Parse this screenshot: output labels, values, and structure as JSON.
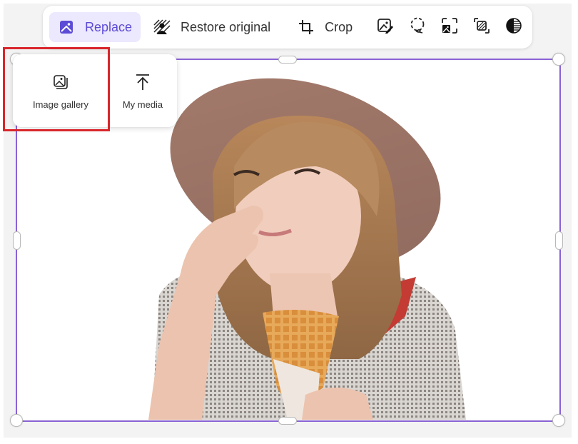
{
  "toolbar": {
    "replace": {
      "label": "Replace",
      "icon": "image-icon",
      "active": true
    },
    "restore": {
      "label": "Restore original",
      "icon": "restore-image-icon"
    },
    "crop": {
      "label": "Crop",
      "icon": "crop-icon"
    },
    "icon_buttons": [
      {
        "name": "edit-image",
        "icon": "image-edit-icon"
      },
      {
        "name": "lasso-select",
        "icon": "lasso-icon"
      },
      {
        "name": "remove-background",
        "icon": "focus-subject-icon"
      },
      {
        "name": "layer-effects",
        "icon": "overlap-icon"
      },
      {
        "name": "adjust-contrast",
        "icon": "contrast-icon"
      }
    ]
  },
  "replace_menu": {
    "items": [
      {
        "label": "Image gallery",
        "icon": "image-gallery-icon",
        "highlighted": true
      },
      {
        "label": "My media",
        "icon": "upload-icon",
        "highlighted": false
      }
    ]
  },
  "canvas": {
    "image_description": "Woman in brown wide-brim hat eating a waffle ice cream cone",
    "selection_color": "#8a63d6",
    "accent_color": "#5b4bd6",
    "highlight_color": "#d9262b"
  }
}
